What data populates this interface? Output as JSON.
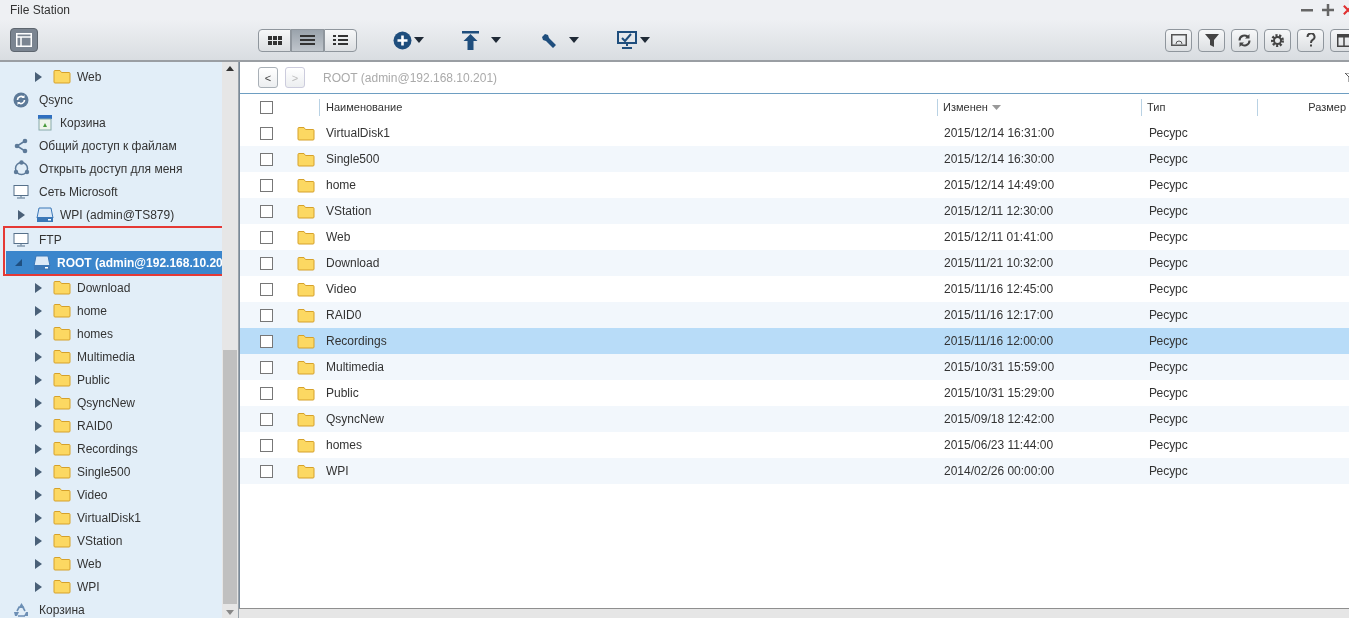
{
  "window": {
    "title": "File Station"
  },
  "toolbar": {
    "view_modes": [
      {
        "kind": "thumbnails",
        "selected": false
      },
      {
        "kind": "list",
        "selected": true
      },
      {
        "kind": "details",
        "selected": false
      }
    ]
  },
  "sidebar": {
    "scrolled_items": [
      {
        "label": "Web",
        "kind": "folder",
        "expanded": false,
        "selected": false
      }
    ],
    "items": [
      {
        "label": "Qsync",
        "kind": "qsync",
        "selected": false,
        "children": [
          {
            "label": "Корзина",
            "kind": "trash-bin",
            "selected": false
          }
        ]
      },
      {
        "label": "Общий доступ к файлам",
        "kind": "share",
        "selected": false
      },
      {
        "label": "Открыть доступ для меня",
        "kind": "shared-with-me",
        "selected": false
      },
      {
        "label": "Сеть Microsoft",
        "kind": "network",
        "selected": false,
        "children": [
          {
            "label": "WPI (admin@TS879)",
            "kind": "drive",
            "expanded": false,
            "selected": false
          }
        ]
      },
      {
        "label": "FTP",
        "kind": "network",
        "selected": false,
        "highlighted": true,
        "children": [
          {
            "label": "ROOT (admin@192.168.10.20",
            "kind": "drive",
            "expanded": true,
            "selected": true,
            "highlighted": true,
            "children": [
              {
                "label": "Download",
                "kind": "folder",
                "expanded": false,
                "selected": false
              },
              {
                "label": "home",
                "kind": "folder",
                "expanded": false,
                "selected": false
              },
              {
                "label": "homes",
                "kind": "folder",
                "expanded": false,
                "selected": false
              },
              {
                "label": "Multimedia",
                "kind": "folder",
                "expanded": false,
                "selected": false
              },
              {
                "label": "Public",
                "kind": "folder",
                "expanded": false,
                "selected": false
              },
              {
                "label": "QsyncNew",
                "kind": "folder",
                "expanded": false,
                "selected": false
              },
              {
                "label": "RAID0",
                "kind": "folder",
                "expanded": false,
                "selected": false
              },
              {
                "label": "Recordings",
                "kind": "folder",
                "expanded": false,
                "selected": false
              },
              {
                "label": "Single500",
                "kind": "folder",
                "expanded": false,
                "selected": false
              },
              {
                "label": "Video",
                "kind": "folder",
                "expanded": false,
                "selected": false
              },
              {
                "label": "VirtualDisk1",
                "kind": "folder",
                "expanded": false,
                "selected": false
              },
              {
                "label": "VStation",
                "kind": "folder",
                "expanded": false,
                "selected": false
              },
              {
                "label": "Web",
                "kind": "folder",
                "expanded": false,
                "selected": false
              },
              {
                "label": "WPI",
                "kind": "folder",
                "expanded": false,
                "selected": false
              }
            ]
          }
        ]
      },
      {
        "label": "Корзина",
        "kind": "recycle",
        "selected": false
      }
    ]
  },
  "path_bar": {
    "back": {
      "label": "<",
      "disabled": false
    },
    "forward": {
      "label": ">",
      "disabled": true
    },
    "path": "ROOT (admin@192.168.10.201)"
  },
  "table": {
    "all_checked": false,
    "columns": [
      {
        "label": "Наименование",
        "sort_descending": false
      },
      {
        "label": "Изменен",
        "sort_descending": true
      },
      {
        "label": "Тип",
        "sort_descending": false
      },
      {
        "label": "Размер",
        "sort_descending": false
      }
    ],
    "rows": [
      {
        "name": "VirtualDisk1",
        "modified": "2015/12/14 16:31:00",
        "type": "Ресурс",
        "checked": false,
        "selected": false
      },
      {
        "name": "Single500",
        "modified": "2015/12/14 16:30:00",
        "type": "Ресурс",
        "checked": false,
        "selected": false
      },
      {
        "name": "home",
        "modified": "2015/12/14 14:49:00",
        "type": "Ресурс",
        "checked": false,
        "selected": false
      },
      {
        "name": "VStation",
        "modified": "2015/12/11 12:30:00",
        "type": "Ресурс",
        "checked": false,
        "selected": false
      },
      {
        "name": "Web",
        "modified": "2015/12/11 01:41:00",
        "type": "Ресурс",
        "checked": false,
        "selected": false
      },
      {
        "name": "Download",
        "modified": "2015/11/21 10:32:00",
        "type": "Ресурс",
        "checked": false,
        "selected": false
      },
      {
        "name": "Video",
        "modified": "2015/11/16 12:45:00",
        "type": "Ресурс",
        "checked": false,
        "selected": false
      },
      {
        "name": "RAID0",
        "modified": "2015/11/16 12:17:00",
        "type": "Ресурс",
        "checked": false,
        "selected": false
      },
      {
        "name": "Recordings",
        "modified": "2015/11/16 12:00:00",
        "type": "Ресурс",
        "checked": false,
        "selected": true
      },
      {
        "name": "Multimedia",
        "modified": "2015/10/31 15:59:00",
        "type": "Ресурс",
        "checked": false,
        "selected": false
      },
      {
        "name": "Public",
        "modified": "2015/10/31 15:29:00",
        "type": "Ресурс",
        "checked": false,
        "selected": false
      },
      {
        "name": "QsyncNew",
        "modified": "2015/09/18 12:42:00",
        "type": "Ресурс",
        "checked": false,
        "selected": false
      },
      {
        "name": "homes",
        "modified": "2015/06/23 11:44:00",
        "type": "Ресурс",
        "checked": false,
        "selected": false
      },
      {
        "name": "WPI",
        "modified": "2014/02/26 00:00:00",
        "type": "Ресурс",
        "checked": false,
        "selected": false
      }
    ]
  }
}
